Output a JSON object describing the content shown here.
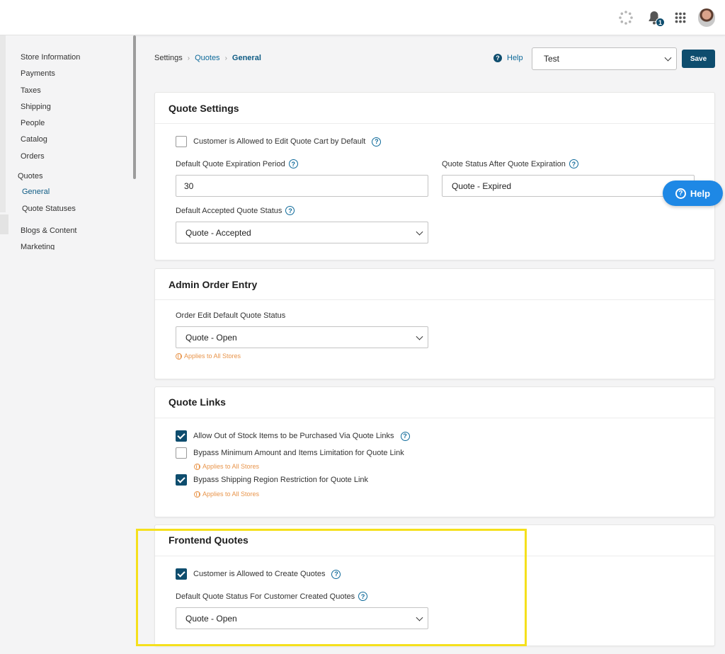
{
  "topbar": {
    "notification_count": "1",
    "icons": [
      "loading-spinner-icon",
      "bell-icon",
      "apps-grid-icon",
      "avatar"
    ]
  },
  "sidebar": {
    "items": [
      "Store Information",
      "Payments",
      "Taxes",
      "Shipping",
      "People",
      "Catalog",
      "Orders"
    ],
    "group_label": "Quotes",
    "sub_items": [
      "General",
      "Quote Statuses"
    ],
    "after_items": [
      "Blogs & Content",
      "Marketing"
    ]
  },
  "breadcrumb": [
    "Settings",
    "Quotes",
    "General"
  ],
  "header": {
    "help_label": "Help",
    "store_select_value": "Test",
    "save_label": "Save"
  },
  "quote_settings": {
    "title": "Quote Settings",
    "allow_edit_label": "Customer is Allowed to Edit Quote Cart by Default",
    "allow_edit_checked": false,
    "expiration_period_label": "Default Quote Expiration Period",
    "expiration_period_value": "30",
    "status_after_expiration_label": "Quote Status After Quote Expiration",
    "status_after_expiration_value": "Quote - Expired",
    "accepted_status_label": "Default Accepted Quote Status",
    "accepted_status_value": "Quote - Accepted"
  },
  "admin_order_entry": {
    "title": "Admin Order Entry",
    "order_edit_status_label": "Order Edit Default Quote Status",
    "order_edit_status_value": "Quote - Open",
    "applies_label": "Applies to All Stores"
  },
  "quote_links": {
    "title": "Quote Links",
    "allow_out_of_stock_label": "Allow Out of Stock Items to be Purchased Via Quote Links",
    "allow_out_of_stock_checked": true,
    "bypass_minimum_label": "Bypass Minimum Amount and Items Limitation for Quote Link",
    "bypass_minimum_checked": false,
    "bypass_minimum_applies": "Applies to All Stores",
    "bypass_shipping_label": "Bypass Shipping Region Restriction for Quote Link",
    "bypass_shipping_checked": true,
    "bypass_shipping_applies": "Applies to All Stores"
  },
  "frontend_quotes": {
    "title": "Frontend Quotes",
    "customer_create_label": "Customer is Allowed to Create Quotes",
    "customer_create_checked": true,
    "default_status_label": "Default Quote Status For Customer Created Quotes",
    "default_status_value": "Quote - Open"
  },
  "floating_help": {
    "label": "Help"
  },
  "colors": {
    "primary": "#0e4d6e",
    "link": "#0e6a9a",
    "help_button": "#1e88e5",
    "applies_text": "#e8944a",
    "highlight": "#f5e01c"
  }
}
